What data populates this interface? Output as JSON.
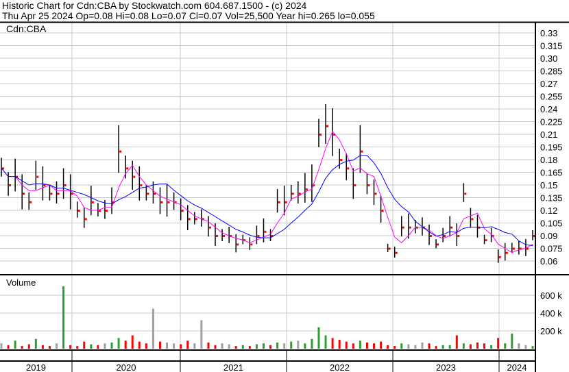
{
  "header": {
    "title": "Historic Chart for Cdn:CBA by Stockwatch.com 604.687.1500 - (c) 2024",
    "quote": "Thu Apr 25 2024  Op=0.08  Hi=0.08  Lo=0.07  Cl=0.07  Vol=25,500  Year hi=0.265  lo=0.055"
  },
  "chart_data": {
    "type": "ohlc",
    "symbol_label": "Cdn:CBA",
    "volume_label": "Volume",
    "price_ticks": [
      "0.33",
      "0.315",
      "0.30",
      "0.285",
      "0.27",
      "0.255",
      "0.24",
      "0.225",
      "0.21",
      "0.195",
      "0.18",
      "0.165",
      "0.15",
      "0.135",
      "0.12",
      "0.105",
      "0.09",
      "0.075",
      "0.06"
    ],
    "price_range": [
      0.045,
      0.345
    ],
    "volume_ticks": [
      "600 k",
      "400 k",
      "200 k"
    ],
    "volume_range_k": [
      0,
      800
    ],
    "years": [
      "2019",
      "2020",
      "2021",
      "2022",
      "2023",
      "2024"
    ],
    "close": [
      0.17,
      0.15,
      0.16,
      0.14,
      0.13,
      0.16,
      0.15,
      0.14,
      0.14,
      0.15,
      0.14,
      0.12,
      0.11,
      0.13,
      0.12,
      0.12,
      0.13,
      0.19,
      0.17,
      0.16,
      0.15,
      0.14,
      0.14,
      0.13,
      0.13,
      0.13,
      0.12,
      0.11,
      0.11,
      0.11,
      0.1,
      0.09,
      0.09,
      0.09,
      0.08,
      0.085,
      0.08,
      0.09,
      0.095,
      0.09,
      0.13,
      0.13,
      0.14,
      0.14,
      0.145,
      0.15,
      0.21,
      0.22,
      0.21,
      0.18,
      0.17,
      0.15,
      0.19,
      0.15,
      0.14,
      0.12,
      0.075,
      0.07,
      0.1,
      0.1,
      0.1,
      0.1,
      0.09,
      0.08,
      0.09,
      0.1,
      0.09,
      0.14,
      0.11,
      0.1,
      0.085,
      0.09,
      0.065,
      0.07,
      0.075,
      0.075,
      0.075,
      0.09
    ],
    "volume_k": [
      60,
      40,
      90,
      30,
      50,
      110,
      40,
      30,
      60,
      700,
      40,
      30,
      80,
      50,
      40,
      60,
      70,
      120,
      90,
      150,
      80,
      60,
      450,
      80,
      70,
      60,
      50,
      90,
      60,
      320,
      70,
      40,
      60,
      50,
      30,
      40,
      30,
      50,
      60,
      40,
      70,
      60,
      80,
      90,
      60,
      110,
      240,
      150,
      120,
      100,
      80,
      60,
      90,
      70,
      60,
      80,
      40,
      30,
      60,
      50,
      40,
      70,
      60,
      30,
      40,
      40,
      150,
      60,
      50,
      70,
      60,
      40,
      120,
      60,
      170,
      60,
      40,
      30
    ],
    "series": [
      {
        "name": "price",
        "color": "#000000"
      },
      {
        "name": "short moving average",
        "color": "#ff00ff"
      },
      {
        "name": "long moving average",
        "color": "#0000ff"
      }
    ],
    "volume_colors": {
      "up": "#2ca02c",
      "down": "#ff0000",
      "flat": "#a0a0a0"
    }
  }
}
